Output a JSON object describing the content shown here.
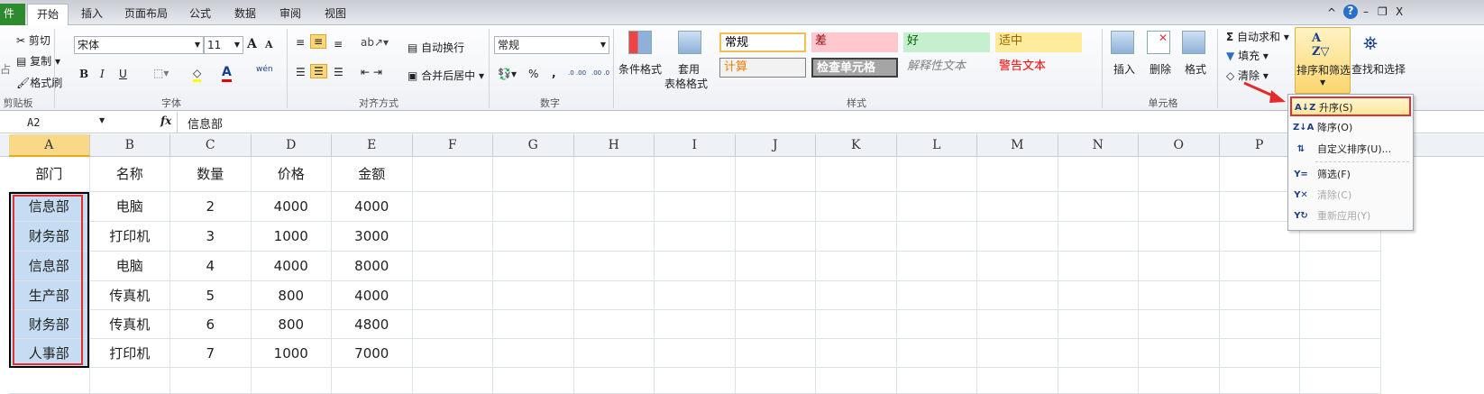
{
  "tabs": [
    "件",
    "开始",
    "插入",
    "页面布局",
    "公式",
    "数据",
    "审阅",
    "视图"
  ],
  "clipboard": {
    "cut": "剪切",
    "copy": "复制",
    "format_painter": "格式刷",
    "label": "剪贴板",
    "paste": "占"
  },
  "font": {
    "name": "宋体",
    "size": "11",
    "label": "字体",
    "bold": "B",
    "italic": "I",
    "underline": "U",
    "grow": "A",
    "shrink": "A",
    "color": "A",
    "phonetic": "wén"
  },
  "alignment": {
    "wrap": "自动换行",
    "merge": "合并后居中",
    "label": "对齐方式"
  },
  "number": {
    "format": "常规",
    "percent": "%",
    "comma": ",",
    "label": "数字",
    "inc": ".0 .00",
    "dec": ".00 .0"
  },
  "styles": {
    "cond_format": "条件格式",
    "table_format_1": "套用",
    "table_format_2": "表格格式",
    "items": [
      {
        "text": "常规",
        "fg": "#000000",
        "bg": "#ffffff"
      },
      {
        "text": "差",
        "fg": "#9c0006",
        "bg": "#ffc7ce"
      },
      {
        "text": "好",
        "fg": "#006100",
        "bg": "#c6efce"
      },
      {
        "text": "适中",
        "fg": "#9c6500",
        "bg": "#ffeb9c"
      },
      {
        "text": "计算",
        "fg": "#fa7d00",
        "bg": "#f2f2f2"
      },
      {
        "text": "检查单元格",
        "fg": "#ffffff",
        "bg": "#a5a5a5"
      },
      {
        "text": "解释性文本",
        "fg": "#7f7f7f",
        "bg": "transparent"
      },
      {
        "text": "警告文本",
        "fg": "#ff0000",
        "bg": "transparent"
      }
    ],
    "label": "样式"
  },
  "cells_group": {
    "insert": "插入",
    "delete": "删除",
    "format": "格式",
    "label": "单元格"
  },
  "editing": {
    "autosum": "自动求和",
    "fill": "填充",
    "clear": "清除",
    "sort_filter": "排序和筛选",
    "find_select": "查找和选择"
  },
  "formula_bar": {
    "name_box": "A2",
    "fx": "fx",
    "value": "信息部"
  },
  "columns": [
    "A",
    "B",
    "C",
    "D",
    "E",
    "F",
    "G",
    "H",
    "I",
    "J",
    "K",
    "L",
    "M",
    "N",
    "O",
    "P"
  ],
  "rows": [
    [
      "部门",
      "名称",
      "数量",
      "价格",
      "金额"
    ],
    [
      "信息部",
      "电脑",
      "2",
      "4000",
      "4000"
    ],
    [
      "财务部",
      "打印机",
      "3",
      "1000",
      "3000"
    ],
    [
      "信息部",
      "电脑",
      "4",
      "4000",
      "8000"
    ],
    [
      "生产部",
      "传真机",
      "5",
      "800",
      "4000"
    ],
    [
      "财务部",
      "传真机",
      "6",
      "800",
      "4800"
    ],
    [
      "人事部",
      "打印机",
      "7",
      "1000",
      "7000"
    ]
  ],
  "menu": [
    {
      "icon": "A↓Z",
      "label": "升序(S)",
      "enabled": true
    },
    {
      "icon": "Z↓A",
      "label": "降序(O)",
      "enabled": true
    },
    {
      "icon": "⇅",
      "label": "自定义排序(U)...",
      "enabled": true
    },
    {
      "icon": "Y=",
      "label": "筛选(F)",
      "enabled": true
    },
    {
      "icon": "Y✕",
      "label": "清除(C)",
      "enabled": false
    },
    {
      "icon": "Y↻",
      "label": "重新应用(Y)",
      "enabled": false
    }
  ],
  "window": {
    "help": "?",
    "min": "–",
    "restore": "❐",
    "close": "X",
    "collapse": "^"
  }
}
